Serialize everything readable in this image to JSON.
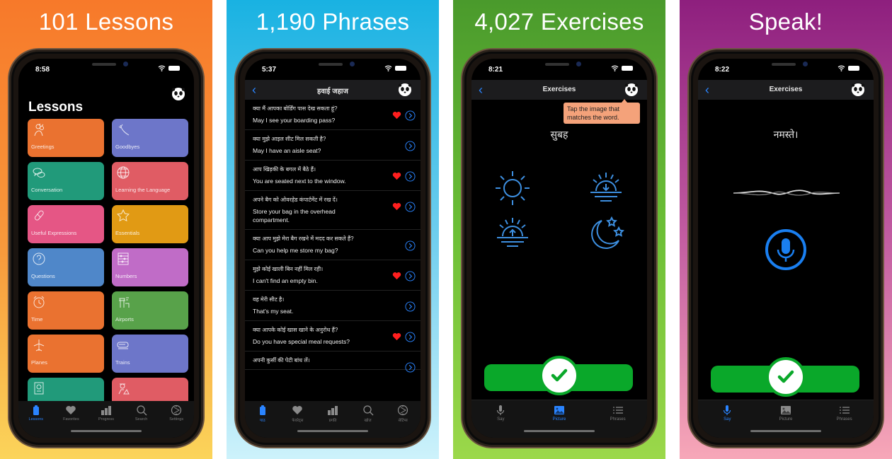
{
  "panels": [
    {
      "headline": "101 Lessons",
      "status_time": "8:58",
      "screen_title": "Lessons",
      "lessons": [
        {
          "label": "Greetings",
          "color": "#ea7230",
          "icon": "people-wave-icon"
        },
        {
          "label": "Goodbyes",
          "color": "#6d76c9",
          "icon": "waving-hand-icon"
        },
        {
          "label": "Conversation",
          "color": "#219a7a",
          "icon": "speech-bubbles-icon"
        },
        {
          "label": "Learning the Language",
          "color": "#e05c64",
          "icon": "globe-icon"
        },
        {
          "label": "Useful Expressions",
          "color": "#e55685",
          "icon": "bandage-icon"
        },
        {
          "label": "Essentials",
          "color": "#e19a14",
          "icon": "star-icon"
        },
        {
          "label": "Questions",
          "color": "#4f87c9",
          "icon": "question-icon"
        },
        {
          "label": "Numbers",
          "color": "#c06cc7",
          "icon": "abacus-icon"
        },
        {
          "label": "Time",
          "color": "#ea7230",
          "icon": "alarm-clock-icon"
        },
        {
          "label": "Airports",
          "color": "#58a24a",
          "icon": "control-tower-icon"
        },
        {
          "label": "Planes",
          "color": "#ea7230",
          "icon": "airplane-icon"
        },
        {
          "label": "Trains",
          "color": "#6d76c9",
          "icon": "train-icon"
        },
        {
          "label": "",
          "color": "#219a7a",
          "icon": "passport-icon"
        },
        {
          "label": "",
          "color": "#e05c64",
          "icon": "officer-icon"
        }
      ],
      "tabs": [
        {
          "label": "Lessons",
          "icon": "lessons-icon",
          "active": true
        },
        {
          "label": "Favorites",
          "icon": "heart-icon",
          "active": false
        },
        {
          "label": "Progress",
          "icon": "bar-chart-icon",
          "active": false
        },
        {
          "label": "Search",
          "icon": "search-icon",
          "active": false
        },
        {
          "label": "Settings",
          "icon": "settings-icon",
          "active": false
        }
      ]
    },
    {
      "headline": "1,190 Phrases",
      "status_time": "5:37",
      "nav_title": "हवाई जहाज",
      "phrases": [
        {
          "hindi": "क्या मैं आपका बोर्डिंग पास देख सकता हूं?",
          "english": "May I see your boarding pass?",
          "favorite": true
        },
        {
          "hindi": "क्या मुझे आइल सीट मिल सकती है?",
          "english": "May I have an aisle seat?",
          "favorite": false
        },
        {
          "hindi": "आप खिड़की के बगल में बैठे हैं।",
          "english": "You are seated next to the window.",
          "favorite": true
        },
        {
          "hindi": "अपने बैग को ओवरहेड कंपार्टमेंट में रख दें।",
          "english": "Store your bag in the overhead compartment.",
          "favorite": true
        },
        {
          "hindi": "क्या आप मुझे मेरा बैग रखने में मदद कर सकते हैं?",
          "english": "Can you help me store my bag?",
          "favorite": false
        },
        {
          "hindi": "मुझे कोई खाली बिन नहीं मिल रही।",
          "english": "I can't find an empty bin.",
          "favorite": true
        },
        {
          "hindi": "वह मेरी सीट है।",
          "english": "That's my seat.",
          "favorite": false
        },
        {
          "hindi": "क्या आपके कोई खास खाने के अनुरोध हैं?",
          "english": "Do you have special meal requests?",
          "favorite": true
        },
        {
          "hindi": "अपनी कुर्सी की पेटी बांध लें।",
          "english": "",
          "favorite": false
        }
      ],
      "tabs": [
        {
          "label": "पाठ",
          "icon": "lessons-icon",
          "active": true
        },
        {
          "label": "फेवरेट्स",
          "icon": "heart-icon",
          "active": false
        },
        {
          "label": "प्रगति",
          "icon": "bar-chart-icon",
          "active": false
        },
        {
          "label": "खोज",
          "icon": "search-icon",
          "active": false
        },
        {
          "label": "सेटिंग्स",
          "icon": "settings-icon",
          "active": false
        }
      ]
    },
    {
      "headline": "4,027 Exercises",
      "status_time": "8:21",
      "nav_title": "Exercises",
      "tooltip": "Tap the image that matches the word.",
      "word": "सुबह",
      "choices": [
        "sun-icon",
        "sunset-icon",
        "sunrise-icon",
        "moon-stars-icon"
      ],
      "tabs": [
        {
          "label": "Say",
          "icon": "microphone-icon",
          "active": false
        },
        {
          "label": "Picture",
          "icon": "picture-icon",
          "active": true
        },
        {
          "label": "Phrases",
          "icon": "list-icon",
          "active": false
        }
      ]
    },
    {
      "headline": "Speak!",
      "status_time": "8:22",
      "nav_title": "Exercises",
      "word": "नमस्ते।",
      "tabs": [
        {
          "label": "Say",
          "icon": "microphone-icon",
          "active": true
        },
        {
          "label": "Picture",
          "icon": "picture-icon",
          "active": false
        },
        {
          "label": "Phrases",
          "icon": "list-icon",
          "active": false
        }
      ]
    }
  ],
  "colors": {
    "accent_blue": "#2a84ff",
    "heart_red": "#ff1e1e",
    "success_green": "#0aa82a",
    "tooltip_bg": "#f4a27a",
    "icon_blue": "#3d8fe0"
  }
}
